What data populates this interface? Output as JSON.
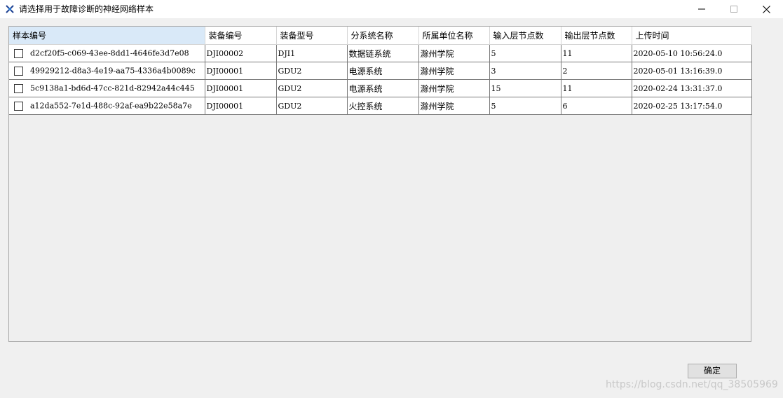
{
  "window": {
    "title": "请选择用于故障诊断的神经网络样本",
    "minimize_icon": "minimize-icon",
    "maximize_icon": "maximize-icon",
    "close_icon": "close-icon"
  },
  "table": {
    "columns": [
      "样本编号",
      "装备编号",
      "装备型号",
      "分系统名称",
      "所属单位名称",
      "输入层节点数",
      "输出层节点数",
      "上传时间"
    ],
    "rows": [
      {
        "checked": false,
        "cells": [
          "d2cf20f5-c069-43ee-8dd1-4646fe3d7e08",
          "DJI00002",
          "DJI1",
          "数据链系统",
          "滁州学院",
          "5",
          "11",
          "2020-05-10 10:56:24.0"
        ]
      },
      {
        "checked": false,
        "cells": [
          "49929212-d8a3-4e19-aa75-4336a4b0089c",
          "DJI00001",
          "GDU2",
          "电源系统",
          "滁州学院",
          "3",
          "2",
          "2020-05-01 13:16:39.0"
        ]
      },
      {
        "checked": false,
        "cells": [
          "5c9138a1-bd6d-47cc-821d-82942a44c445",
          "DJI00001",
          "GDU2",
          "电源系统",
          "滁州学院",
          "15",
          "11",
          "2020-02-24 13:31:37.0"
        ]
      },
      {
        "checked": false,
        "cells": [
          "a12da552-7e1d-488c-92af-ea9b22e58a7e",
          "DJI00001",
          "GDU2",
          "火控系统",
          "滁州学院",
          "5",
          "6",
          "2020-02-25 13:17:54.0"
        ]
      }
    ]
  },
  "actions": {
    "confirm_label": "确定"
  },
  "watermark": "https://blog.csdn.net/qq_38505969",
  "colors": {
    "header_selected": "#d9e9f8",
    "background": "#f0f0f0"
  }
}
